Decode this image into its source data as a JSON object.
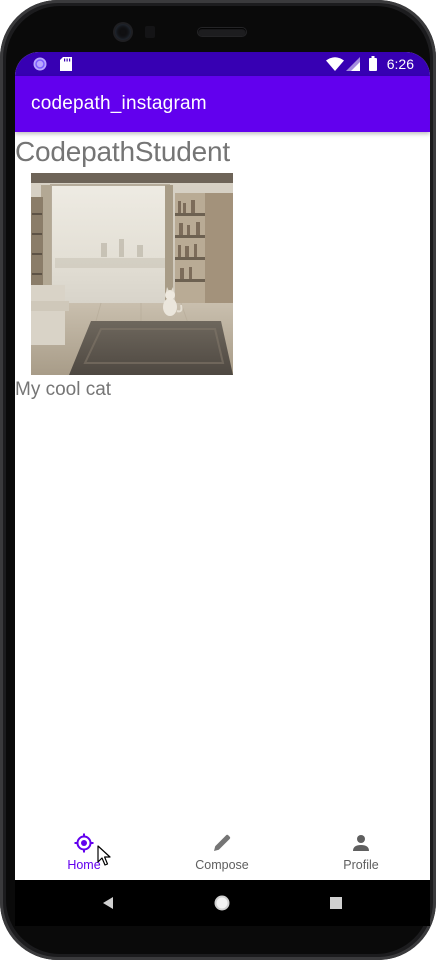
{
  "status_bar": {
    "time": "6:26",
    "icons": [
      "app-notification-icon",
      "sd-card-icon",
      "wifi-icon",
      "cell-signal-icon",
      "battery-icon"
    ],
    "background": "#3700b3"
  },
  "app_bar": {
    "title": "codepath_instagram",
    "background": "#6200ee"
  },
  "post": {
    "username": "CodepathStudent",
    "image_alt": "cat in a sunny living room",
    "caption": "My cool cat"
  },
  "bottom_nav": {
    "active": "Home",
    "accent": "#6200ee",
    "items": [
      {
        "label": "Home",
        "icon": "home-target-icon"
      },
      {
        "label": "Compose",
        "icon": "pencil-icon"
      },
      {
        "label": "Profile",
        "icon": "person-icon"
      }
    ]
  },
  "system_nav": {
    "buttons": [
      "back-icon",
      "home-circle-icon",
      "recents-square-icon"
    ]
  }
}
